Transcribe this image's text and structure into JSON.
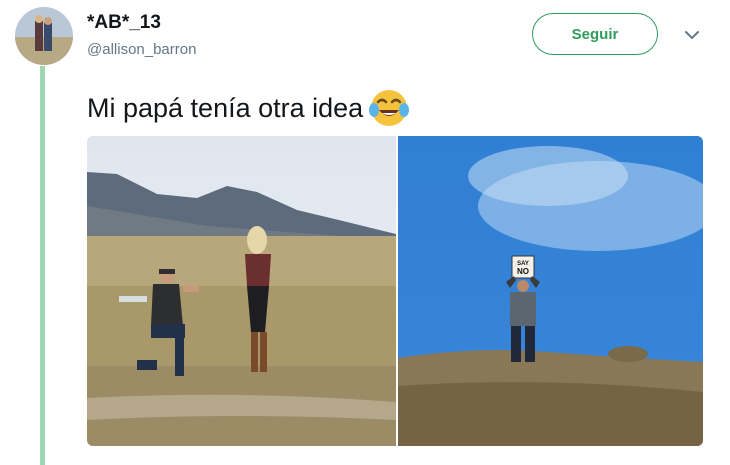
{
  "user": {
    "display_name": "*AB*_13",
    "handle": "@allison_barron",
    "avatar_icon": "profile-photo-couple"
  },
  "header": {
    "follow_label": "Seguir",
    "more_icon": "chevron-down-icon"
  },
  "tweet": {
    "text": "Mi papá tenía otra idea",
    "emoji": "face-with-tears-of-joy-emoji"
  },
  "media": {
    "photos": [
      {
        "name": "proposal-photo",
        "description_icon": "photo"
      },
      {
        "name": "sign-photo",
        "sign_text": "SAY NO"
      }
    ]
  },
  "colors": {
    "accent": "#2e9e5a",
    "thread_line": "#9fd6b2",
    "handle_gray": "#657786"
  }
}
